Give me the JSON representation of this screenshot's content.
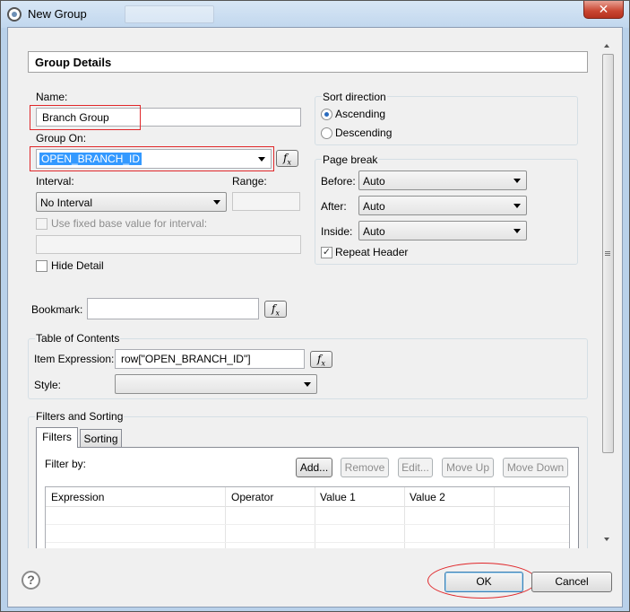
{
  "window": {
    "title": "New Group",
    "close_glyph": "✕"
  },
  "header": {
    "title": "Group Details"
  },
  "name": {
    "label": "Name:",
    "value": "Branch Group"
  },
  "group_on": {
    "label": "Group On:",
    "value": "OPEN_BRANCH_ID"
  },
  "interval": {
    "label": "Interval:",
    "value": "No Interval"
  },
  "range": {
    "label": "Range:"
  },
  "fixed_base": {
    "label": "Use fixed base value for interval:",
    "checked": false
  },
  "hide_detail": {
    "label": "Hide Detail",
    "checked": false
  },
  "sort_direction": {
    "title": "Sort direction",
    "options": [
      {
        "label": "Ascending",
        "selected": true
      },
      {
        "label": "Descending",
        "selected": false
      }
    ]
  },
  "page_break": {
    "title": "Page break",
    "before": {
      "label": "Before:",
      "value": "Auto"
    },
    "after": {
      "label": "After:",
      "value": "Auto"
    },
    "inside": {
      "label": "Inside:",
      "value": "Auto"
    },
    "repeat_header": {
      "label": "Repeat Header",
      "checked": true,
      "mark": "✓"
    }
  },
  "bookmark": {
    "label": "Bookmark:",
    "value": ""
  },
  "toc": {
    "title": "Table of Contents",
    "item_expression": {
      "label": "Item Expression:",
      "value": "row[\"OPEN_BRANCH_ID\"]"
    },
    "style": {
      "label": "Style:",
      "value": ""
    }
  },
  "filters_sorting": {
    "title": "Filters and Sorting",
    "tabs": [
      "Filters",
      "Sorting"
    ],
    "filter_by_label": "Filter by:",
    "buttons": [
      "Add...",
      "Remove",
      "Edit...",
      "Move Up",
      "Move Down"
    ],
    "columns": [
      "Expression",
      "Operator",
      "Value 1",
      "Value 2"
    ]
  },
  "fx_label": "f",
  "fx_sub": "x",
  "footer": {
    "help_glyph": "?",
    "ok": "OK",
    "cancel": "Cancel"
  },
  "colors": {
    "highlight_red": "#e0272a",
    "selection_blue": "#3399ff",
    "frame_blue": "#b9d1ea"
  }
}
